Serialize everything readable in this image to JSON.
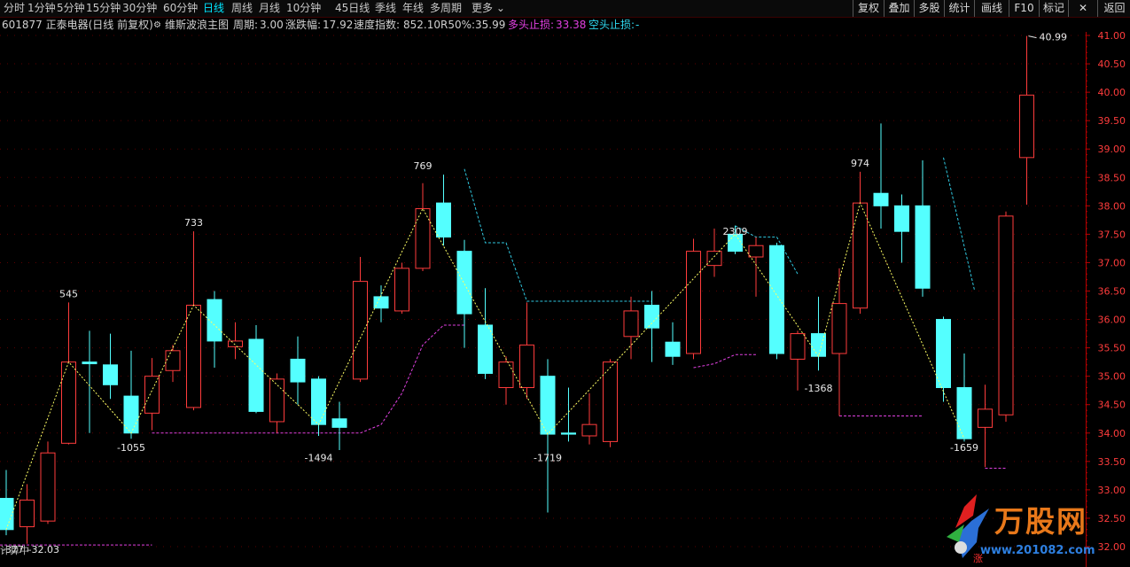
{
  "tabs": {
    "periods": [
      "分时",
      "1分钟",
      "5分钟",
      "15分钟",
      "30分钟",
      "60分钟",
      "日线",
      "周线",
      "月线",
      "10分钟",
      "45日线",
      "季线",
      "年线",
      "多周期",
      "更多"
    ],
    "active": "日线",
    "right_buttons": [
      "复权",
      "叠加",
      "多股",
      "统计",
      "画线",
      "F10",
      "标记",
      "返回"
    ]
  },
  "info": {
    "title": "601877 正泰电器(日线 前复权)",
    "indicator": "维斯波浪主图",
    "period_label": "周期:",
    "period_value": "3.00",
    "change_label": "涨跌幅:",
    "change_value": "17.92",
    "speed_label": "速度指数:",
    "speed_value": "852.10",
    "r50_label": "R50%:",
    "r50_value": "35.99",
    "long_stop_label": "多头止损:",
    "long_stop_value": "33.38",
    "short_stop_label": "空头止损:",
    "short_stop_value": "-"
  },
  "colors": {
    "up": "#ff3c3c",
    "down": "#54ffff",
    "axis": "#b40000",
    "grid": "#5a0000",
    "wave": "#ffff64",
    "long_stop": "#e040e0",
    "short_stop": "#30c8e0",
    "active_tab": "#00e5ff"
  },
  "chart_data": {
    "type": "candlestick",
    "y_axis": {
      "min": 32.0,
      "max": 41.0,
      "step": 0.5,
      "ticks": [
        "41.00",
        "40.50",
        "40.00",
        "39.50",
        "39.00",
        "38.50",
        "38.00",
        "37.50",
        "37.00",
        "36.50",
        "36.00",
        "35.50",
        "35.00",
        "34.50",
        "34.00",
        "33.50",
        "33.00",
        "32.50",
        "32.00"
      ]
    },
    "candles": [
      {
        "o": 32.85,
        "c": 32.3,
        "h": 33.35,
        "l": 32.2
      },
      {
        "o": 32.35,
        "c": 32.82,
        "h": 33.1,
        "l": 32.05
      },
      {
        "o": 32.45,
        "c": 33.65,
        "h": 33.85,
        "l": 32.4
      },
      {
        "o": 33.82,
        "c": 35.25,
        "h": 36.3,
        "l": 33.8
      },
      {
        "o": 35.25,
        "c": 35.22,
        "h": 35.8,
        "l": 34.0
      },
      {
        "o": 35.2,
        "c": 34.85,
        "h": 35.75,
        "l": 34.6
      },
      {
        "o": 34.65,
        "c": 34.0,
        "h": 35.45,
        "l": 33.9
      },
      {
        "o": 34.35,
        "c": 35.0,
        "h": 35.32,
        "l": 34.05
      },
      {
        "o": 35.1,
        "c": 35.45,
        "h": 35.55,
        "l": 34.9
      },
      {
        "o": 34.45,
        "c": 36.25,
        "h": 37.55,
        "l": 34.4
      },
      {
        "o": 36.35,
        "c": 35.62,
        "h": 36.5,
        "l": 35.15
      },
      {
        "o": 35.52,
        "c": 35.62,
        "h": 35.95,
        "l": 35.3
      },
      {
        "o": 35.65,
        "c": 34.38,
        "h": 35.9,
        "l": 34.35
      },
      {
        "o": 34.2,
        "c": 34.95,
        "h": 35.05,
        "l": 34.0
      },
      {
        "o": 35.3,
        "c": 34.9,
        "h": 35.7,
        "l": 34.5
      },
      {
        "o": 34.95,
        "c": 34.15,
        "h": 35.0,
        "l": 33.95
      },
      {
        "o": 34.25,
        "c": 34.1,
        "h": 34.55,
        "l": 33.7
      },
      {
        "o": 34.95,
        "c": 36.67,
        "h": 37.1,
        "l": 34.9
      },
      {
        "o": 36.4,
        "c": 36.2,
        "h": 36.6,
        "l": 35.95
      },
      {
        "o": 36.15,
        "c": 36.9,
        "h": 37.0,
        "l": 36.1
      },
      {
        "o": 36.9,
        "c": 37.95,
        "h": 38.4,
        "l": 36.85
      },
      {
        "o": 38.05,
        "c": 37.45,
        "h": 38.55,
        "l": 37.3
      },
      {
        "o": 37.2,
        "c": 36.1,
        "h": 37.4,
        "l": 35.5
      },
      {
        "o": 35.9,
        "c": 35.05,
        "h": 36.55,
        "l": 34.95
      },
      {
        "o": 34.8,
        "c": 35.25,
        "h": 35.35,
        "l": 34.5
      },
      {
        "o": 34.8,
        "c": 35.55,
        "h": 36.3,
        "l": 34.6
      },
      {
        "o": 35.0,
        "c": 33.98,
        "h": 35.3,
        "l": 32.6
      },
      {
        "o": 34.0,
        "c": 33.98,
        "h": 34.8,
        "l": 33.85
      },
      {
        "o": 33.95,
        "c": 34.15,
        "h": 34.7,
        "l": 33.8
      },
      {
        "o": 33.85,
        "c": 35.25,
        "h": 35.3,
        "l": 33.75
      },
      {
        "o": 35.7,
        "c": 36.15,
        "h": 36.4,
        "l": 35.3
      },
      {
        "o": 36.25,
        "c": 35.85,
        "h": 36.5,
        "l": 35.25
      },
      {
        "o": 35.6,
        "c": 35.35,
        "h": 35.95,
        "l": 35.2
      },
      {
        "o": 35.4,
        "c": 37.2,
        "h": 37.42,
        "l": 35.3
      },
      {
        "o": 36.95,
        "c": 37.2,
        "h": 37.6,
        "l": 36.75
      },
      {
        "o": 37.5,
        "c": 37.2,
        "h": 37.65,
        "l": 37.15
      },
      {
        "o": 37.1,
        "c": 37.3,
        "h": 37.45,
        "l": 36.4
      },
      {
        "o": 37.3,
        "c": 35.4,
        "h": 37.35,
        "l": 35.3
      },
      {
        "o": 35.3,
        "c": 35.75,
        "h": 35.8,
        "l": 34.75
      },
      {
        "o": 35.75,
        "c": 35.35,
        "h": 36.4,
        "l": 35.1
      },
      {
        "o": 35.4,
        "c": 36.28,
        "h": 36.9,
        "l": 34.3
      },
      {
        "o": 36.2,
        "c": 38.05,
        "h": 38.6,
        "l": 36.1
      },
      {
        "o": 38.22,
        "c": 38.0,
        "h": 39.45,
        "l": 37.6
      },
      {
        "o": 38.0,
        "c": 37.55,
        "h": 38.2,
        "l": 37.0
      },
      {
        "o": 38.0,
        "c": 36.55,
        "h": 38.8,
        "l": 36.4
      },
      {
        "o": 36.0,
        "c": 34.8,
        "h": 36.05,
        "l": 34.55
      },
      {
        "o": 34.8,
        "c": 33.9,
        "h": 35.4,
        "l": 33.85
      },
      {
        "o": 34.1,
        "c": 34.42,
        "h": 34.85,
        "l": 33.4
      },
      {
        "o": 34.32,
        "c": 37.82,
        "h": 37.9,
        "l": 34.2
      },
      {
        "o": 38.85,
        "c": 39.95,
        "h": 40.99,
        "l": 38.02
      }
    ],
    "wave_labels": [
      {
        "i": 0,
        "y": 32.05,
        "text": "-377"
      },
      {
        "i": 3,
        "y": 36.3,
        "text": "545"
      },
      {
        "i": 6,
        "y": 33.9,
        "text": "-1055"
      },
      {
        "i": 9,
        "y": 37.55,
        "text": "733"
      },
      {
        "i": 15,
        "y": 33.72,
        "text": "-1494"
      },
      {
        "i": 20,
        "y": 38.55,
        "text": "769"
      },
      {
        "i": 26,
        "y": 33.72,
        "text": "-1719"
      },
      {
        "i": 35,
        "y": 37.4,
        "text": "2309"
      },
      {
        "i": 39,
        "y": 34.95,
        "text": "-1368"
      },
      {
        "i": 41,
        "y": 38.6,
        "text": "974"
      },
      {
        "i": 46,
        "y": 33.9,
        "text": "-1659"
      },
      {
        "i": 49,
        "y": 40.99,
        "text": "40.99"
      }
    ],
    "bottom_price_label": "32.03",
    "long_stop_line": [
      [
        7,
        34.0
      ],
      [
        8,
        34.0
      ],
      [
        9,
        34.0
      ],
      [
        17,
        34.0
      ],
      [
        18,
        34.15
      ],
      [
        19,
        34.7
      ],
      [
        20,
        35.55
      ],
      [
        21,
        35.9
      ],
      [
        22,
        35.9
      ]
    ],
    "short_stop_line": [
      [
        22,
        38.65
      ],
      [
        23,
        37.35
      ],
      [
        24,
        37.35
      ],
      [
        25,
        36.32
      ],
      [
        31,
        36.32
      ]
    ]
  },
  "watermark": {
    "title": "万股网",
    "url": "www.201082.com"
  },
  "bottom_left_label": "计算中",
  "bottom_mark": "涨"
}
